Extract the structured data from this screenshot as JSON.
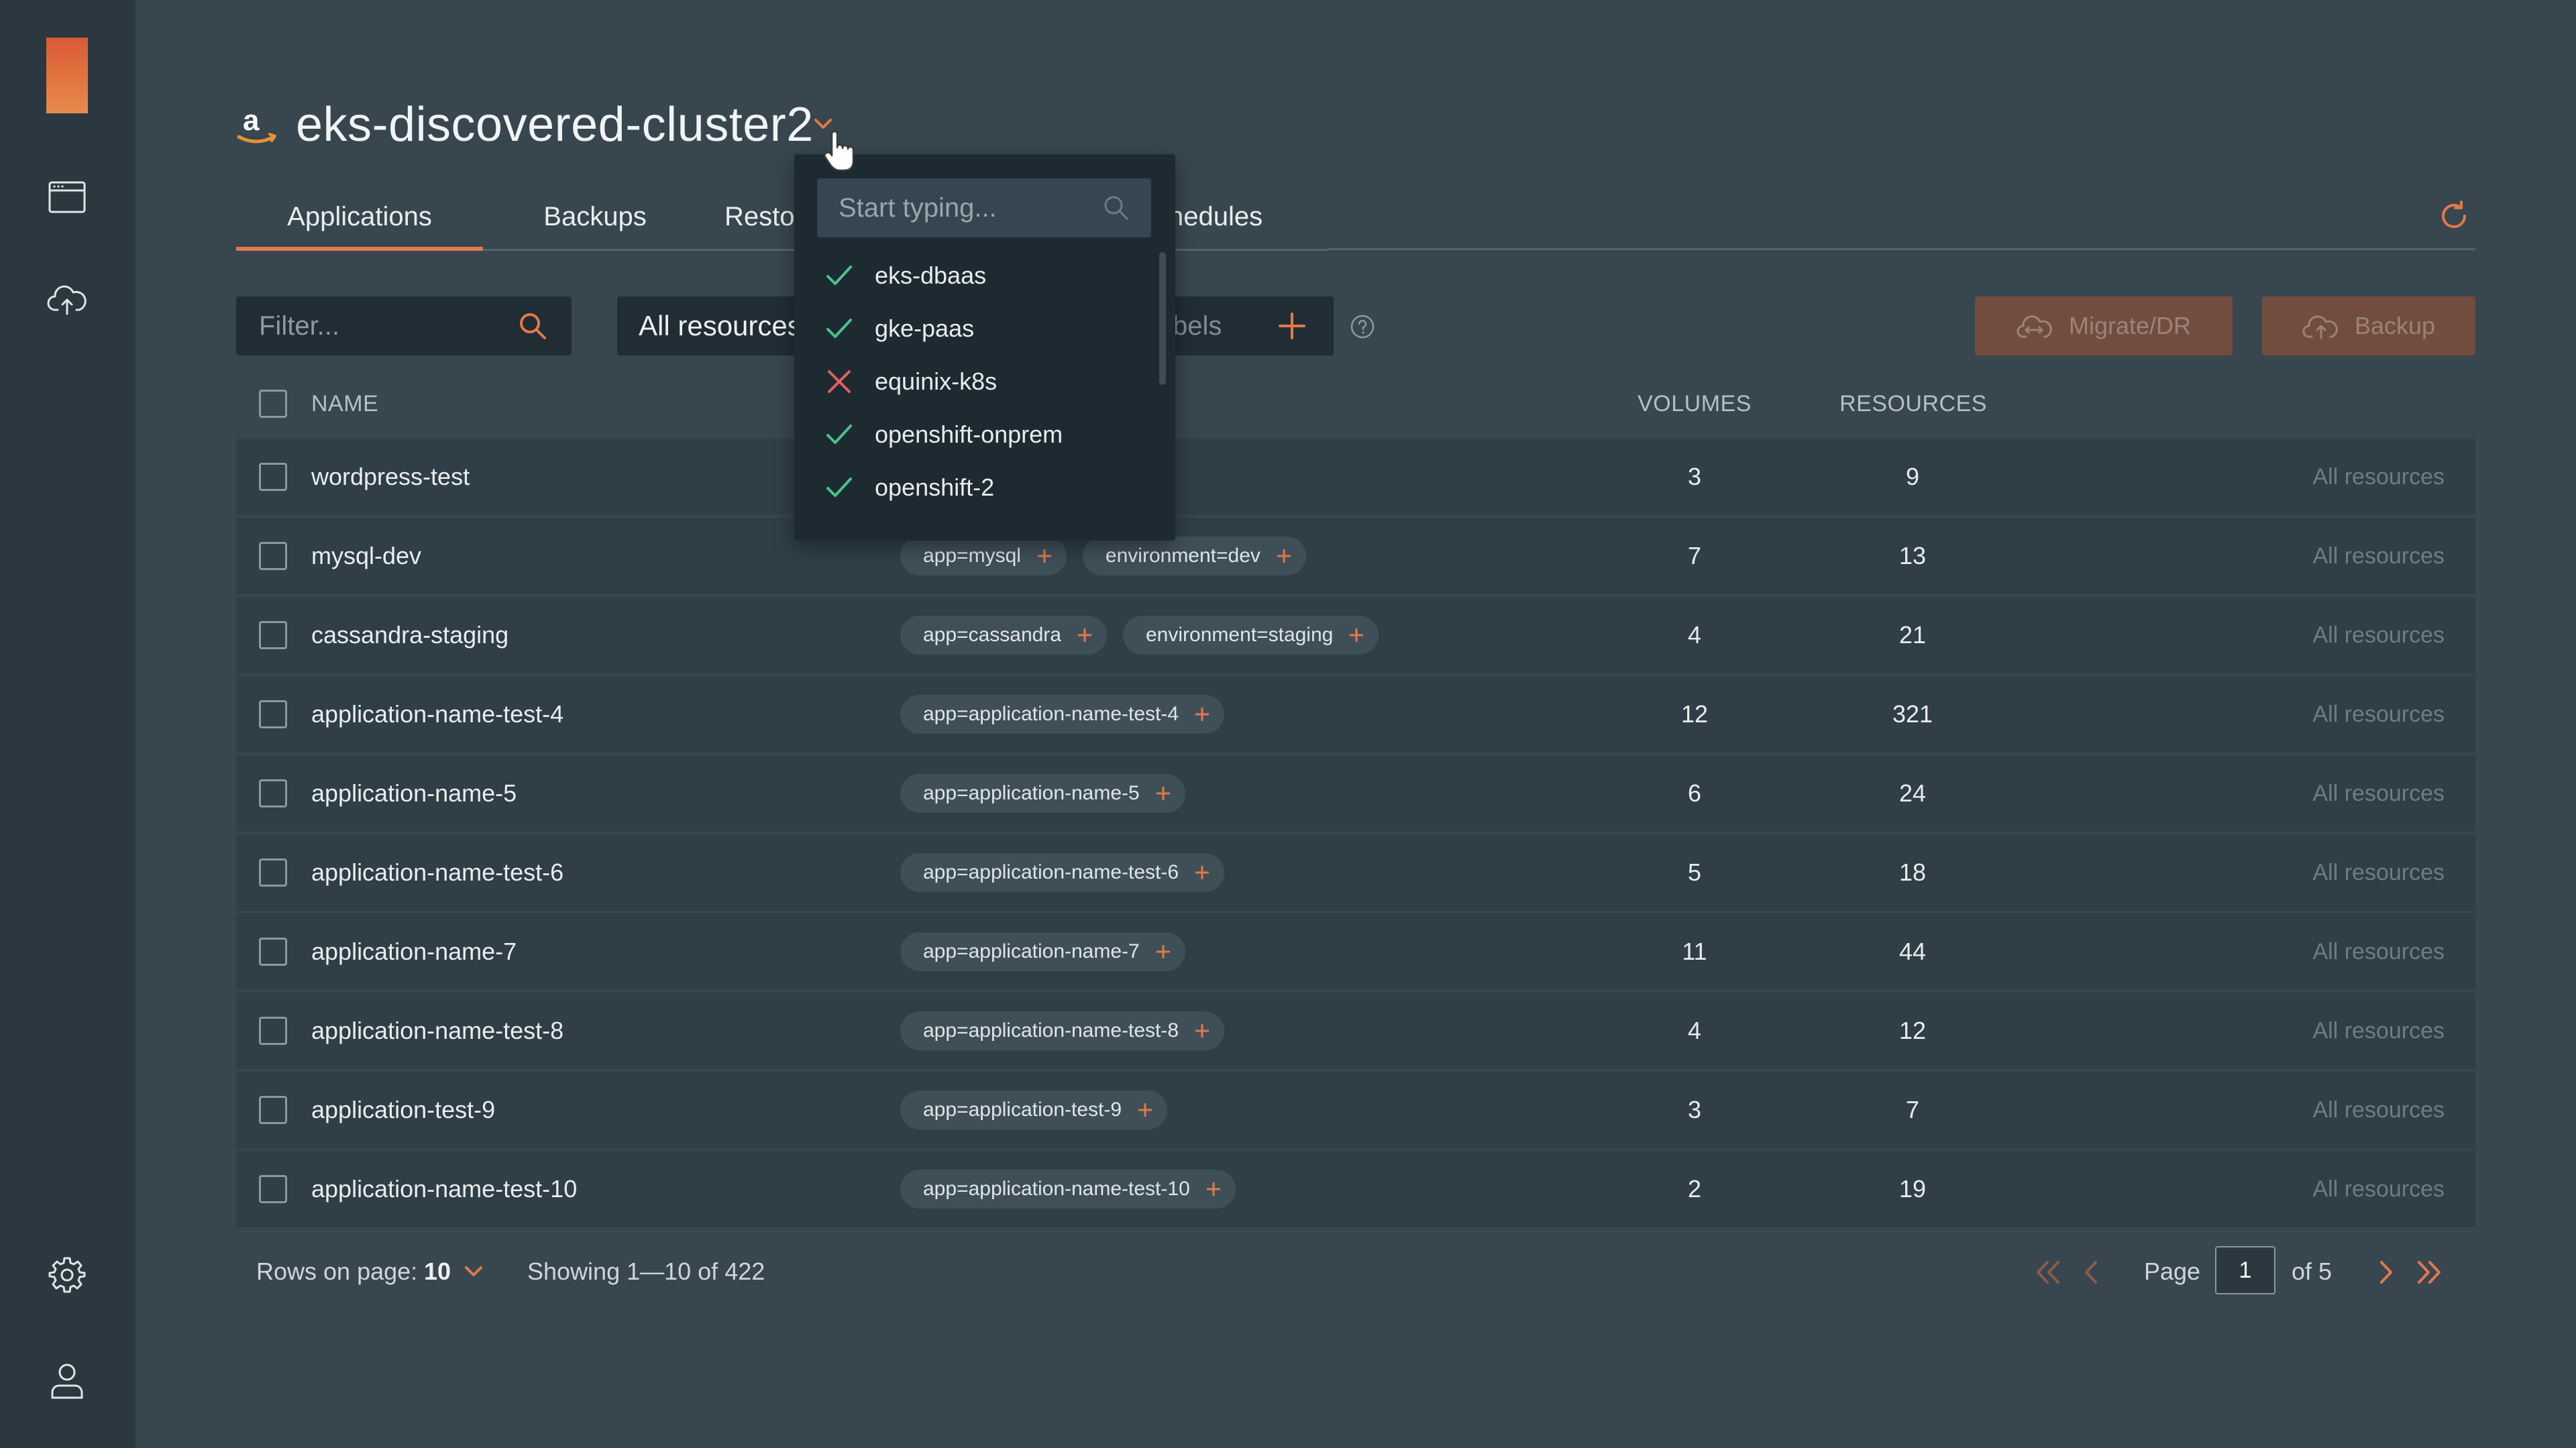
{
  "header": {
    "cluster_name": "eks-discovered-cluster2"
  },
  "tabs": [
    {
      "label": "Applications",
      "active": true
    },
    {
      "label": "Backups",
      "active": false
    },
    {
      "label": "Resto",
      "active": false
    },
    {
      "label": "chedules",
      "active": false
    }
  ],
  "toolbar": {
    "filter_placeholder": "Filter...",
    "resource_select_value": "All resources",
    "labels_placeholder": "bels",
    "migrate_label": "Migrate/DR",
    "backup_label": "Backup"
  },
  "table": {
    "columns": {
      "name": "NAME",
      "volumes": "VOLUMES",
      "resources": "RESOURCES"
    },
    "rows": [
      {
        "name": "wordpress-test",
        "labels": [],
        "volumes": "3",
        "resources": "9",
        "scope": "All resources"
      },
      {
        "name": "mysql-dev",
        "labels": [
          "app=mysql",
          "environment=dev"
        ],
        "volumes": "7",
        "resources": "13",
        "scope": "All resources"
      },
      {
        "name": "cassandra-staging",
        "labels": [
          "app=cassandra",
          "environment=staging"
        ],
        "volumes": "4",
        "resources": "21",
        "scope": "All resources"
      },
      {
        "name": "application-name-test-4",
        "labels": [
          "app=application-name-test-4"
        ],
        "volumes": "12",
        "resources": "321",
        "scope": "All resources"
      },
      {
        "name": "application-name-5",
        "labels": [
          "app=application-name-5"
        ],
        "volumes": "6",
        "resources": "24",
        "scope": "All resources"
      },
      {
        "name": "application-name-test-6",
        "labels": [
          "app=application-name-test-6"
        ],
        "volumes": "5",
        "resources": "18",
        "scope": "All resources"
      },
      {
        "name": "application-name-7",
        "labels": [
          "app=application-name-7"
        ],
        "volumes": "11",
        "resources": "44",
        "scope": "All resources"
      },
      {
        "name": "application-name-test-8",
        "labels": [
          "app=application-name-test-8"
        ],
        "volumes": "4",
        "resources": "12",
        "scope": "All resources"
      },
      {
        "name": "application-test-9",
        "labels": [
          "app=application-test-9"
        ],
        "volumes": "3",
        "resources": "7",
        "scope": "All resources"
      },
      {
        "name": "application-name-test-10",
        "labels": [
          "app=application-name-test-10"
        ],
        "volumes": "2",
        "resources": "19",
        "scope": "All resources"
      }
    ]
  },
  "pagination": {
    "rows_label": "Rows on page:",
    "rows_value": "10",
    "showing": "Showing 1—10 of 422",
    "page_label": "Page",
    "page_value": "1",
    "of_label": "of",
    "total_pages": "5"
  },
  "cluster_dropdown": {
    "search_placeholder": "Start typing...",
    "items": [
      {
        "label": "eks-dbaas",
        "status": "ok"
      },
      {
        "label": "gke-paas",
        "status": "ok"
      },
      {
        "label": "equinix-k8s",
        "status": "error"
      },
      {
        "label": "openshift-onprem",
        "status": "ok"
      },
      {
        "label": "openshift-2",
        "status": "ok"
      }
    ]
  },
  "colors": {
    "accent": "#e2794a",
    "ok": "#4cc28a",
    "error": "#e5605f",
    "background": "#37464f",
    "sidebar": "#2b3840",
    "row": "#2f3e47"
  },
  "icons": {
    "sidebar": [
      "browser-window-icon",
      "cloud-upload-icon",
      "gear-icon",
      "user-icon"
    ],
    "cluster": "amazon-logo-icon"
  }
}
